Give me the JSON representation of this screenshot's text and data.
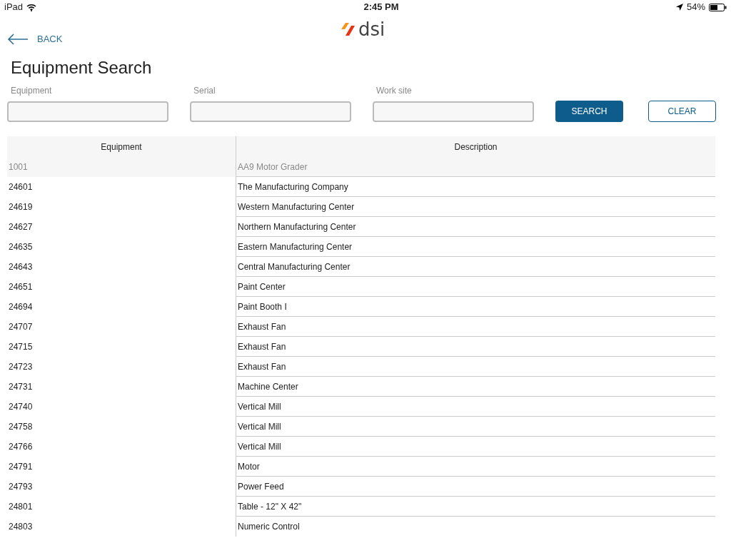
{
  "status_bar": {
    "device": "iPad",
    "time": "2:45 PM",
    "battery": "54%"
  },
  "nav": {
    "back": "BACK",
    "logo": "dsi"
  },
  "title": "Equipment Search",
  "fields": [
    {
      "label": "Equipment"
    },
    {
      "label": "Serial"
    },
    {
      "label": "Work site"
    }
  ],
  "buttons": [
    {
      "label": "SEARCH",
      "kind": "primary"
    },
    {
      "label": "CLEAR",
      "kind": "secondary"
    }
  ],
  "table": {
    "columns": [
      "Equipment",
      "Description"
    ],
    "rows": [
      {
        "cells": [
          "1001",
          "AA9 Motor Grader"
        ],
        "selected": true
      },
      {
        "cells": [
          "24601",
          "The Manufacturing Company"
        ],
        "selected": false
      },
      {
        "cells": [
          "24619",
          "Western Manufacturing Center"
        ],
        "selected": false
      },
      {
        "cells": [
          "24627",
          "Northern Manufacturing Center"
        ],
        "selected": false
      },
      {
        "cells": [
          "24635",
          "Eastern Manufacturing Center"
        ],
        "selected": false
      },
      {
        "cells": [
          "24643",
          "Central Manufacturing Center"
        ],
        "selected": false
      },
      {
        "cells": [
          "24651",
          "Paint Center"
        ],
        "selected": false
      },
      {
        "cells": [
          "24694",
          "Paint Booth I"
        ],
        "selected": false
      },
      {
        "cells": [
          "24707",
          "Exhaust Fan"
        ],
        "selected": false
      },
      {
        "cells": [
          "24715",
          "Exhaust Fan"
        ],
        "selected": false
      },
      {
        "cells": [
          "24723",
          "Exhaust Fan"
        ],
        "selected": false
      },
      {
        "cells": [
          "24731",
          "Machine Center"
        ],
        "selected": false
      },
      {
        "cells": [
          "24740",
          "Vertical Mill"
        ],
        "selected": false
      },
      {
        "cells": [
          "24758",
          "Vertical Mill"
        ],
        "selected": false
      },
      {
        "cells": [
          "24766",
          "Vertical Mill"
        ],
        "selected": false
      },
      {
        "cells": [
          "24791",
          "Motor"
        ],
        "selected": false
      },
      {
        "cells": [
          "24793",
          "Power Feed"
        ],
        "selected": false
      },
      {
        "cells": [
          "24801",
          "Table - 12\" X 42\""
        ],
        "selected": false
      },
      {
        "cells": [
          "24803",
          "Numeric Control"
        ],
        "selected": false
      }
    ]
  }
}
